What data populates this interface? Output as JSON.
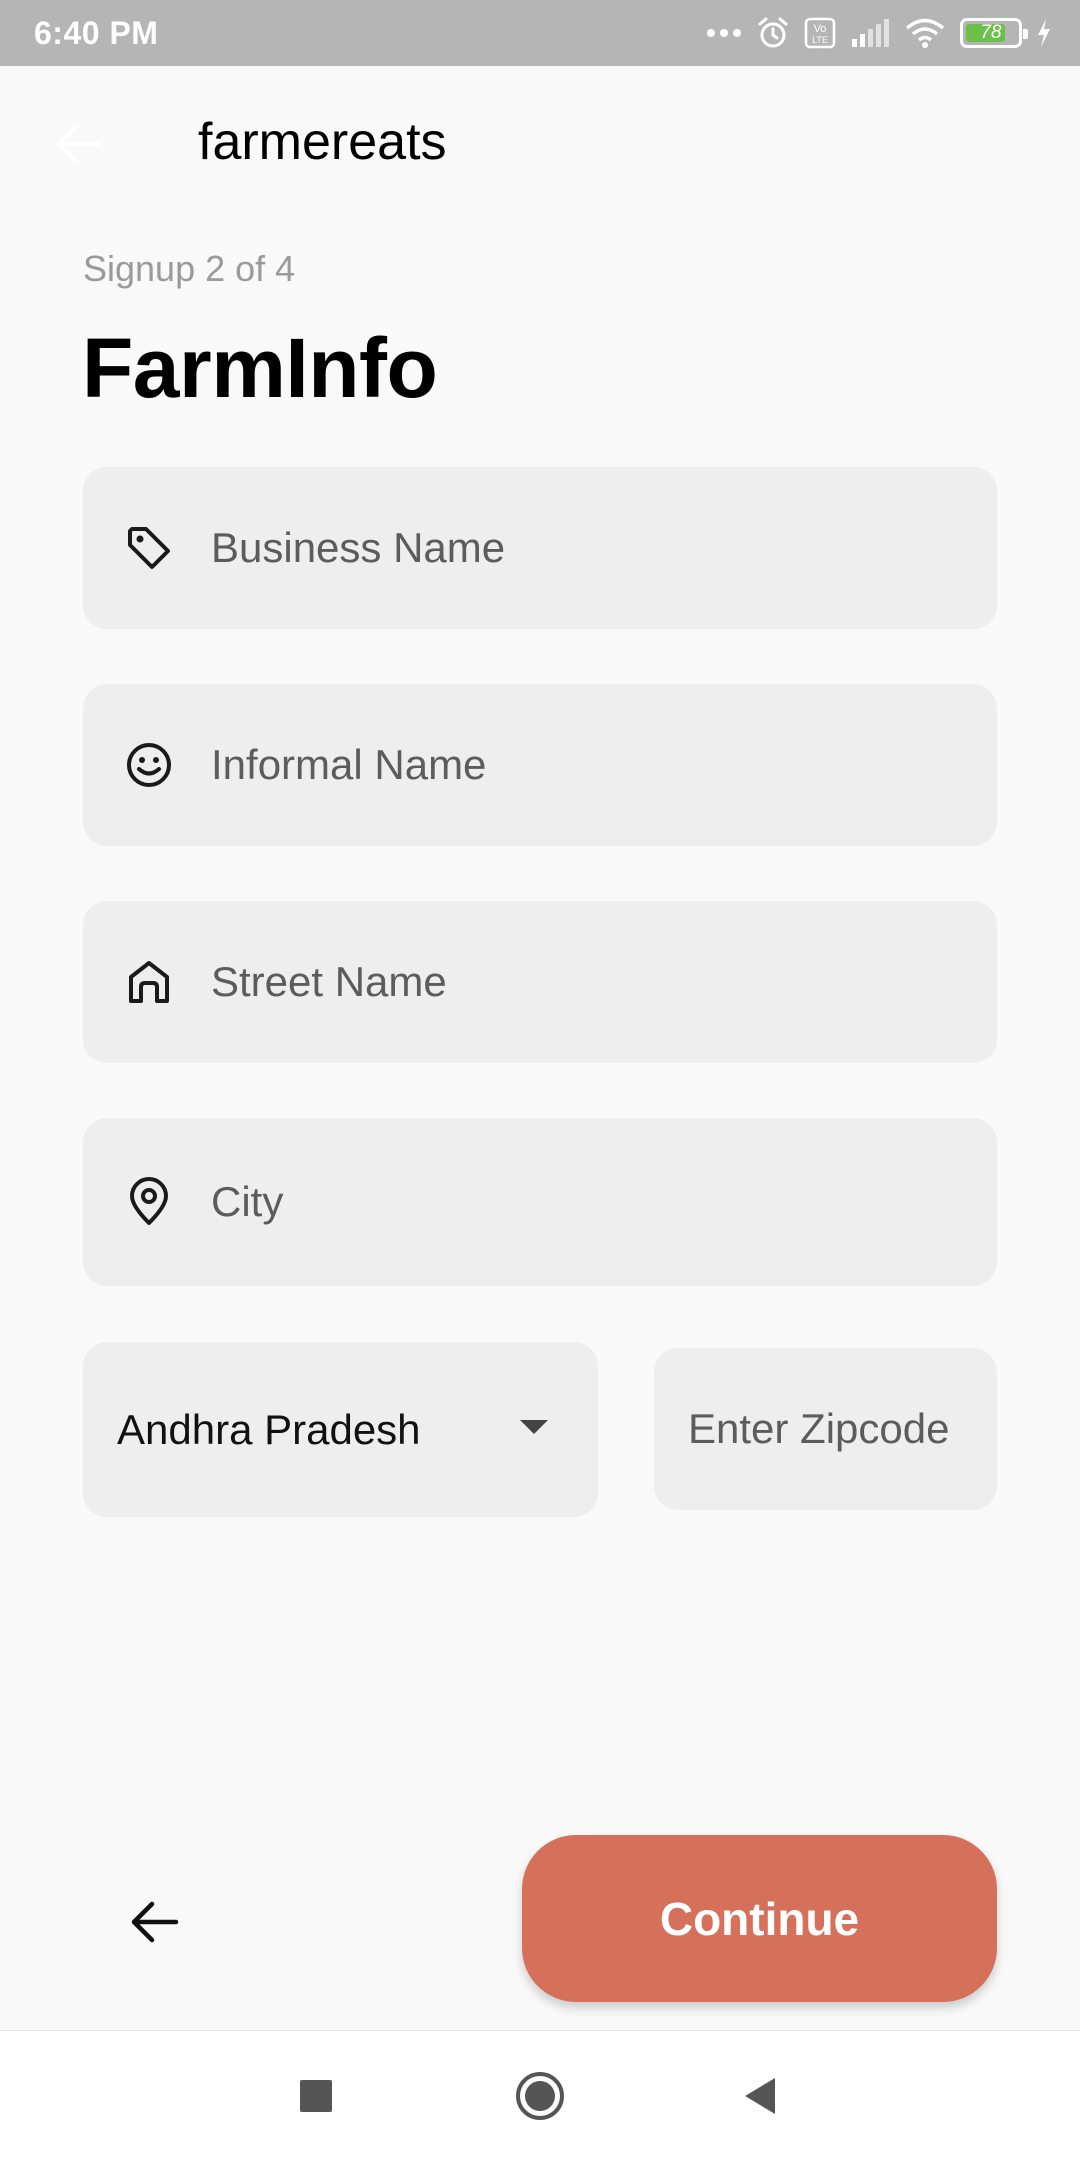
{
  "status_bar": {
    "time": "6:40 PM",
    "battery_level": "78",
    "battery_fraction": 0.78,
    "network_badge": "Vo LTE",
    "icons": [
      "more-dots-icon",
      "alarm-icon",
      "volte-icon",
      "signal-icon",
      "wifi-icon",
      "battery-icon",
      "charging-icon"
    ]
  },
  "app_bar": {
    "title": "farmereats",
    "back_icon": "arrow-left-icon"
  },
  "form": {
    "step_label": "Signup 2 of 4",
    "title": "FarmInfo",
    "fields": [
      {
        "icon": "tag-icon",
        "placeholder": "Business Name"
      },
      {
        "icon": "smiley-icon",
        "placeholder": "Informal Name"
      },
      {
        "icon": "home-icon",
        "placeholder": "Street Name"
      },
      {
        "icon": "location-pin-icon",
        "placeholder": "City"
      }
    ],
    "state": {
      "value": "Andhra Pradesh",
      "icon": "dropdown-arrow-icon"
    },
    "zipcode": {
      "placeholder": "Enter Zipcode"
    }
  },
  "actions": {
    "back_icon": "arrow-left-icon",
    "continue_label": "Continue"
  },
  "system_nav": {
    "icons": [
      "recents-square-icon",
      "home-circle-icon",
      "back-triangle-icon"
    ]
  },
  "colors": {
    "accent": "#d5715b",
    "field_bg": "#eeeeee",
    "page_bg": "#f9f9f9",
    "status_bar_bg": "#b5b5b5",
    "battery_green": "#6cc04a"
  }
}
